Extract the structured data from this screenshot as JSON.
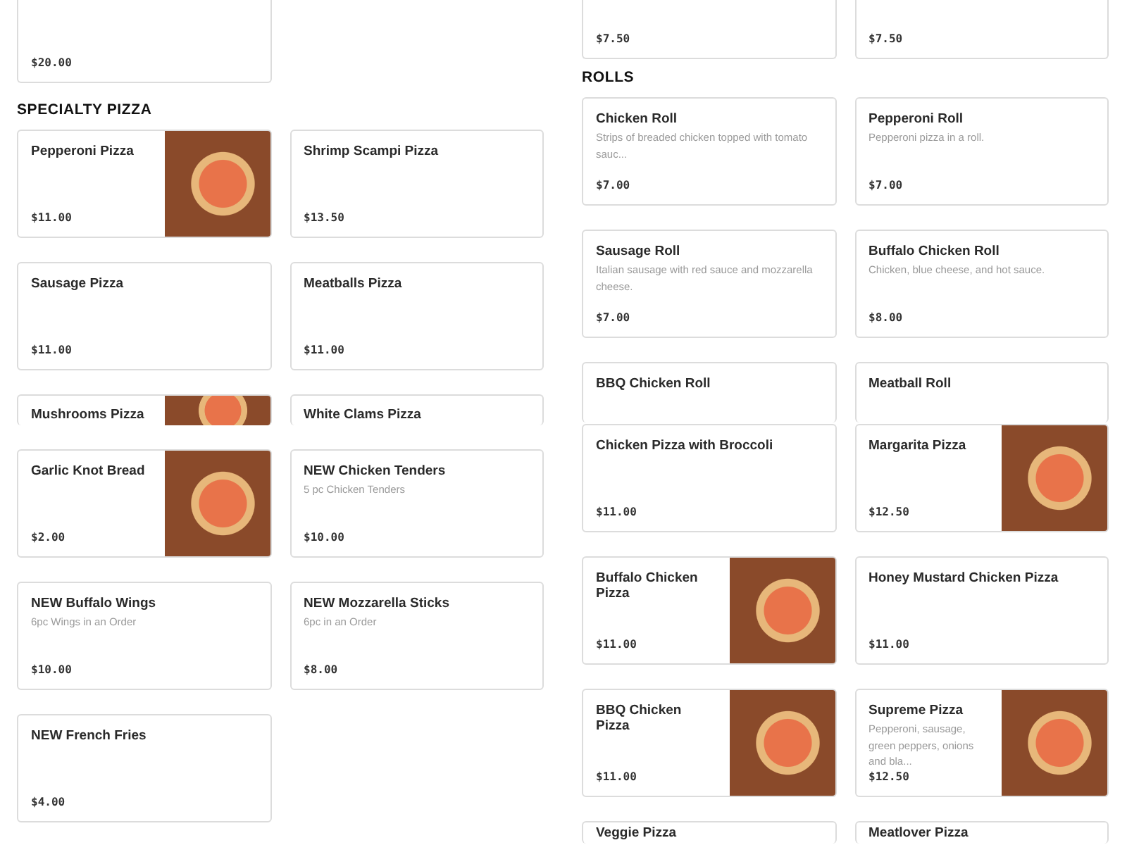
{
  "columns": [
    {
      "blocks": [
        {
          "kind": "tail",
          "items": [
            {
              "price": "$20.00",
              "photo": false
            }
          ]
        },
        {
          "kind": "heading",
          "text": "SPECIALTY PIZZA"
        },
        {
          "kind": "grid",
          "items": [
            {
              "name": "Pepperoni Pizza",
              "price": "$11.00",
              "photo": true
            },
            {
              "name": "Shrimp Scampi Pizza",
              "price": "$13.50",
              "photo": false
            },
            {
              "name": "Sausage Pizza",
              "price": "$11.00",
              "photo": false
            },
            {
              "name": "Meatballs Pizza",
              "price": "$11.00",
              "photo": false
            }
          ]
        },
        {
          "kind": "clipped",
          "items": [
            {
              "name": "Mushrooms Pizza",
              "photo": true
            },
            {
              "name": "White Clams Pizza",
              "photo": false
            }
          ]
        },
        {
          "kind": "grid",
          "items": [
            {
              "name": "Garlic Knot Bread",
              "price": "$2.00",
              "photo": true
            },
            {
              "name": "NEW Chicken Tenders",
              "description": "5 pc Chicken Tenders",
              "price": "$10.00",
              "photo": false
            },
            {
              "name": "NEW Buffalo Wings",
              "description": "6pc Wings in an Order",
              "price": "$10.00",
              "photo": false
            },
            {
              "name": "NEW Mozzarella Sticks",
              "description": "6pc in an Order",
              "price": "$8.00",
              "photo": false
            },
            {
              "name": "NEW French Fries",
              "price": "$4.00",
              "photo": false
            }
          ]
        }
      ]
    },
    {
      "blocks": [
        {
          "kind": "tail",
          "items": [
            {
              "price": "$7.50",
              "photo": false
            },
            {
              "price": "$7.50",
              "photo": false
            }
          ]
        },
        {
          "kind": "heading",
          "text": "ROLLS"
        },
        {
          "kind": "grid",
          "items": [
            {
              "name": "Chicken Roll",
              "description": "Strips of breaded chicken topped with tomato sauc...",
              "price": "$7.00",
              "photo": false
            },
            {
              "name": "Pepperoni Roll",
              "description": "Pepperoni pizza in a roll.",
              "price": "$7.00",
              "photo": false
            },
            {
              "name": "Sausage Roll",
              "description": "Italian sausage with red sauce and mozzarella cheese.",
              "price": "$7.00",
              "photo": false
            },
            {
              "name": "Buffalo Chicken Roll",
              "description": "Chicken, blue cheese, and hot sauce.",
              "price": "$8.00",
              "photo": false
            }
          ]
        },
        {
          "kind": "clipped",
          "items": [
            {
              "name": "BBQ Chicken Roll",
              "photo": false
            },
            {
              "name": "Meatball Roll",
              "photo": false
            }
          ]
        },
        {
          "kind": "grid",
          "items": [
            {
              "name": "Chicken Pizza with Broccoli",
              "price": "$11.00",
              "photo": false
            },
            {
              "name": "Margarita Pizza",
              "price": "$12.50",
              "photo": true
            },
            {
              "name": "Buffalo Chicken Pizza",
              "price": "$11.00",
              "photo": true
            },
            {
              "name": "Honey Mustard Chicken Pizza",
              "price": "$11.00",
              "photo": false
            },
            {
              "name": "BBQ Chicken Pizza",
              "price": "$11.00",
              "photo": true
            },
            {
              "name": "Supreme Pizza",
              "description": "Pepperoni, sausage, green peppers, onions and bla...",
              "price": "$12.50",
              "photo": true
            }
          ]
        },
        {
          "kind": "bottom",
          "items": [
            {
              "name": "Veggie Pizza",
              "photo": false
            },
            {
              "name": "Meatlover Pizza",
              "photo": false
            }
          ]
        }
      ]
    }
  ]
}
